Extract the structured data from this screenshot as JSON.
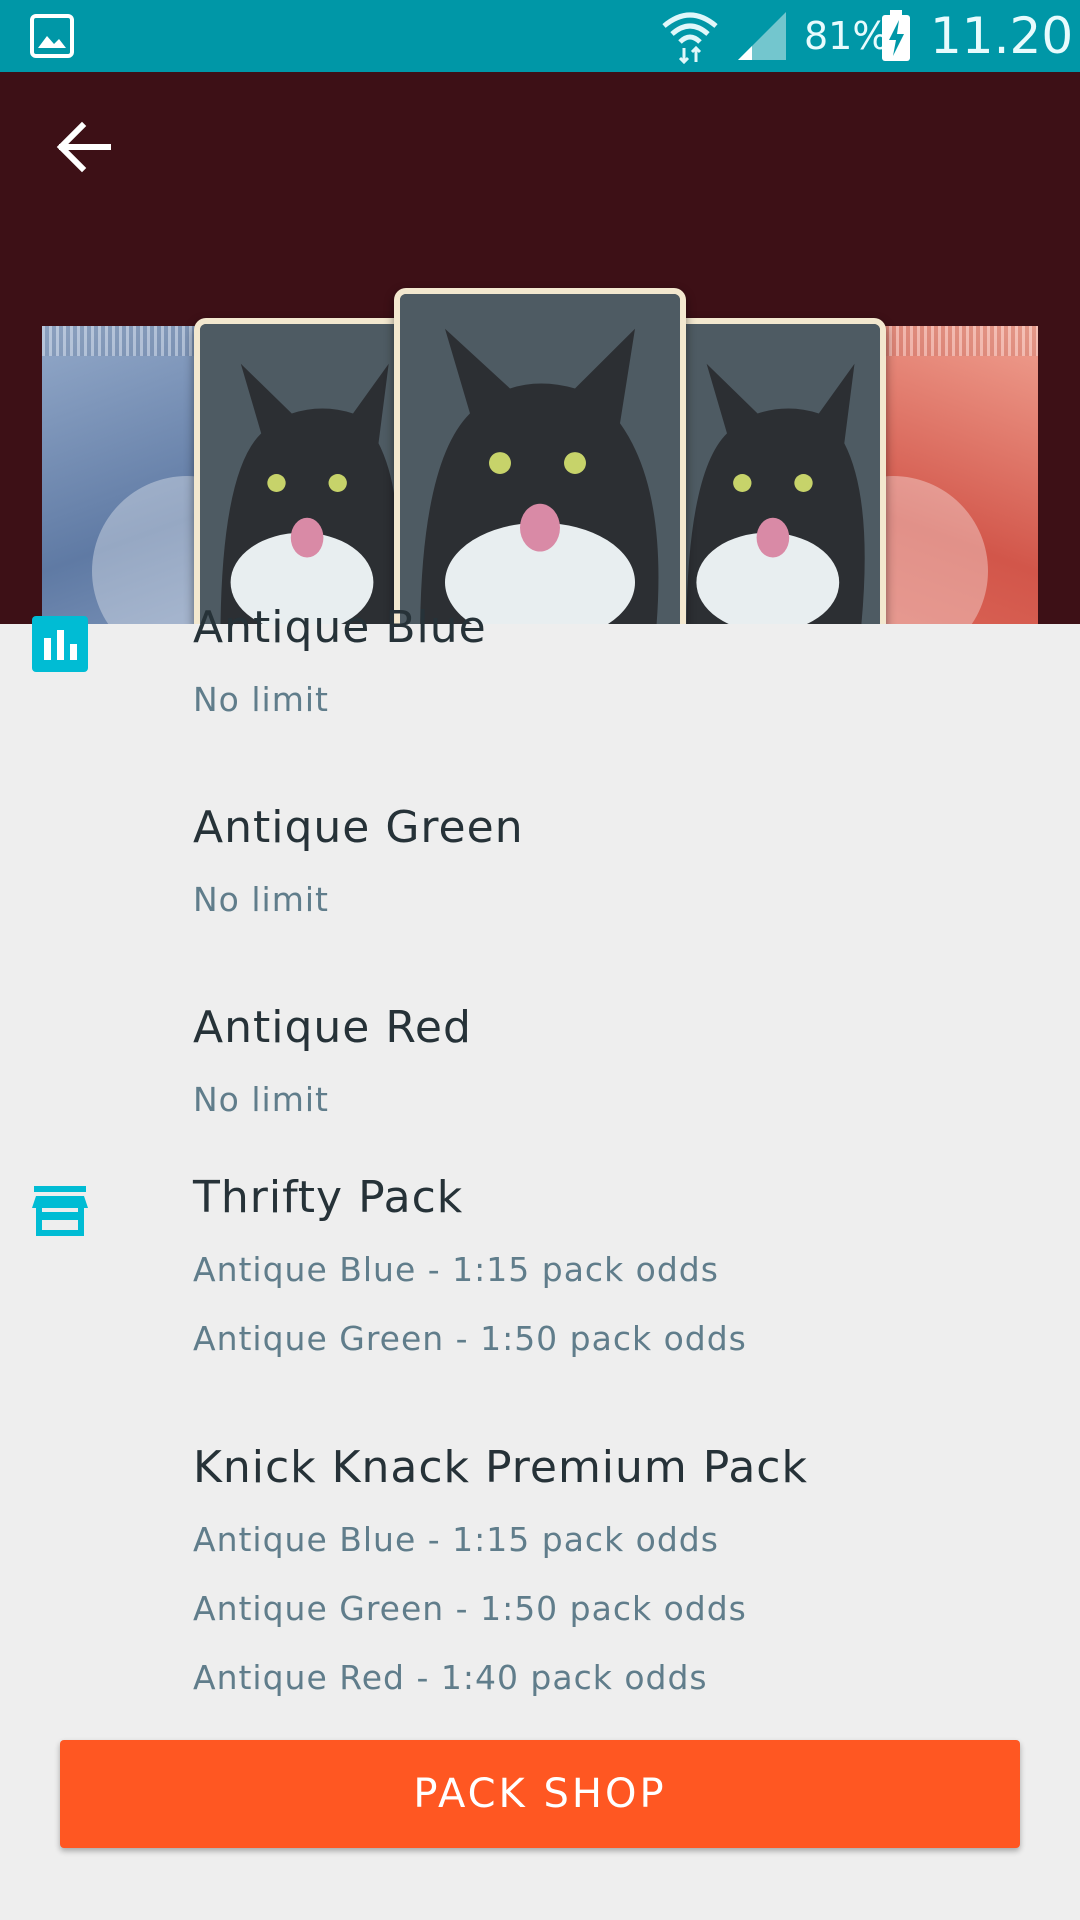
{
  "status_bar": {
    "battery_percent": "81%",
    "time": "11.20",
    "icons": [
      "gallery-icon",
      "wifi-icon",
      "signal-icon",
      "battery-charging-icon"
    ],
    "color": "#0097a7"
  },
  "header": {
    "back_icon": "arrow-back-icon",
    "background_color": "#3d1016"
  },
  "sections": {
    "rarity": {
      "icon": "bar-chart-icon",
      "items": [
        {
          "title": "Antique Blue",
          "subtitle": "No limit"
        },
        {
          "title": "Antique Green",
          "subtitle": "No limit"
        },
        {
          "title": "Antique Red",
          "subtitle": "No limit"
        }
      ]
    },
    "packs": {
      "icon": "store-icon",
      "items": [
        {
          "title": "Thrifty Pack",
          "odds": [
            "Antique Blue - 1:15 pack odds",
            "Antique Green - 1:50 pack odds"
          ]
        },
        {
          "title": "Knick Knack Premium Pack",
          "odds": [
            "Antique Blue - 1:15 pack odds",
            "Antique Green - 1:50 pack odds",
            "Antique Red - 1:40 pack odds"
          ]
        }
      ]
    }
  },
  "actions": {
    "pack_shop_label": "PACK SHOP",
    "accent_color": "#ff5722",
    "icon_color": "#00bcd4"
  }
}
